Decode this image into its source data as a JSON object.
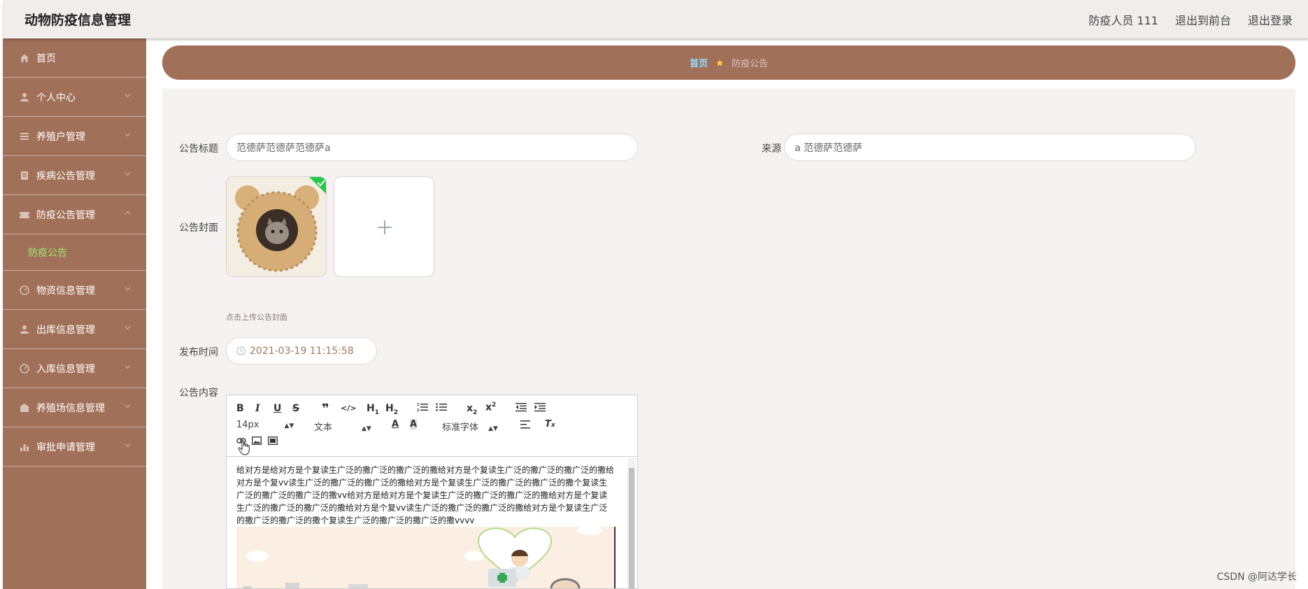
{
  "header": {
    "app_title": "动物防疫信息管理",
    "user_label": "防疫人员 111",
    "front_link": "退出到前台",
    "logout_link": "退出登录"
  },
  "sidebar": {
    "items": [
      {
        "label": "首页",
        "icon": "home-icon"
      },
      {
        "label": "个人中心",
        "icon": "user-icon"
      },
      {
        "label": "养殖户管理",
        "icon": "list-icon"
      },
      {
        "label": "疾病公告管理",
        "icon": "document-icon"
      },
      {
        "label": "防疫公告管理",
        "icon": "ticket-icon",
        "expanded": true,
        "sub": "防疫公告"
      },
      {
        "label": "物资信息管理",
        "icon": "gauge-icon"
      },
      {
        "label": "出库信息管理",
        "icon": "user-icon"
      },
      {
        "label": "入库信息管理",
        "icon": "gauge-icon"
      },
      {
        "label": "养殖场信息管理",
        "icon": "building-icon"
      },
      {
        "label": "审批申请管理",
        "icon": "chart-icon"
      }
    ],
    "active_sub": "防疫公告"
  },
  "breadcrumb": {
    "home": "首页",
    "current": "防疫公告"
  },
  "form": {
    "title_label": "公告标题",
    "title_value": "范德萨范德萨范德萨a",
    "source_label": "来源",
    "source_value": "a 范德萨范德萨",
    "cover_label": "公告封面",
    "cover_hint": "点击上传公告封面",
    "time_label": "发布时间",
    "time_value": "2021-03-19 11:15:58",
    "content_label": "公告内容"
  },
  "editor": {
    "font_size": "14px",
    "block_format": "文本",
    "font_family": "标准字体",
    "content": "给对方是给对方是个复读生广泛的撒广泛的撒广泛的撒给对方是个复读生广泛的撒广泛的撒广泛的撒给对方是个复vv读生广泛的撒广泛的撒广泛的撒给对方是个复读生广泛的撒广泛的撒广泛的撒个复读生广泛的撒广泛的撒广泛的撒vv给对方是给对方是个复读生广泛的撒广泛的撒广泛的撒给对方是个复读生广泛的撒广泛的撒广泛的撒给对方是个复vv读生广泛的撒广泛的撒广泛的撒给对方是个复读生广泛的撒广泛的撒广泛的撒个复读生广泛的撒广泛的撒广泛的撒vvvv"
  },
  "watermark": "CSDN @阿达学长",
  "colors": {
    "sidebar": "#a17059",
    "active_sub": "#9fe870",
    "breadcrumb_home": "#8fe0ff",
    "panel": "#f6f2f2"
  }
}
